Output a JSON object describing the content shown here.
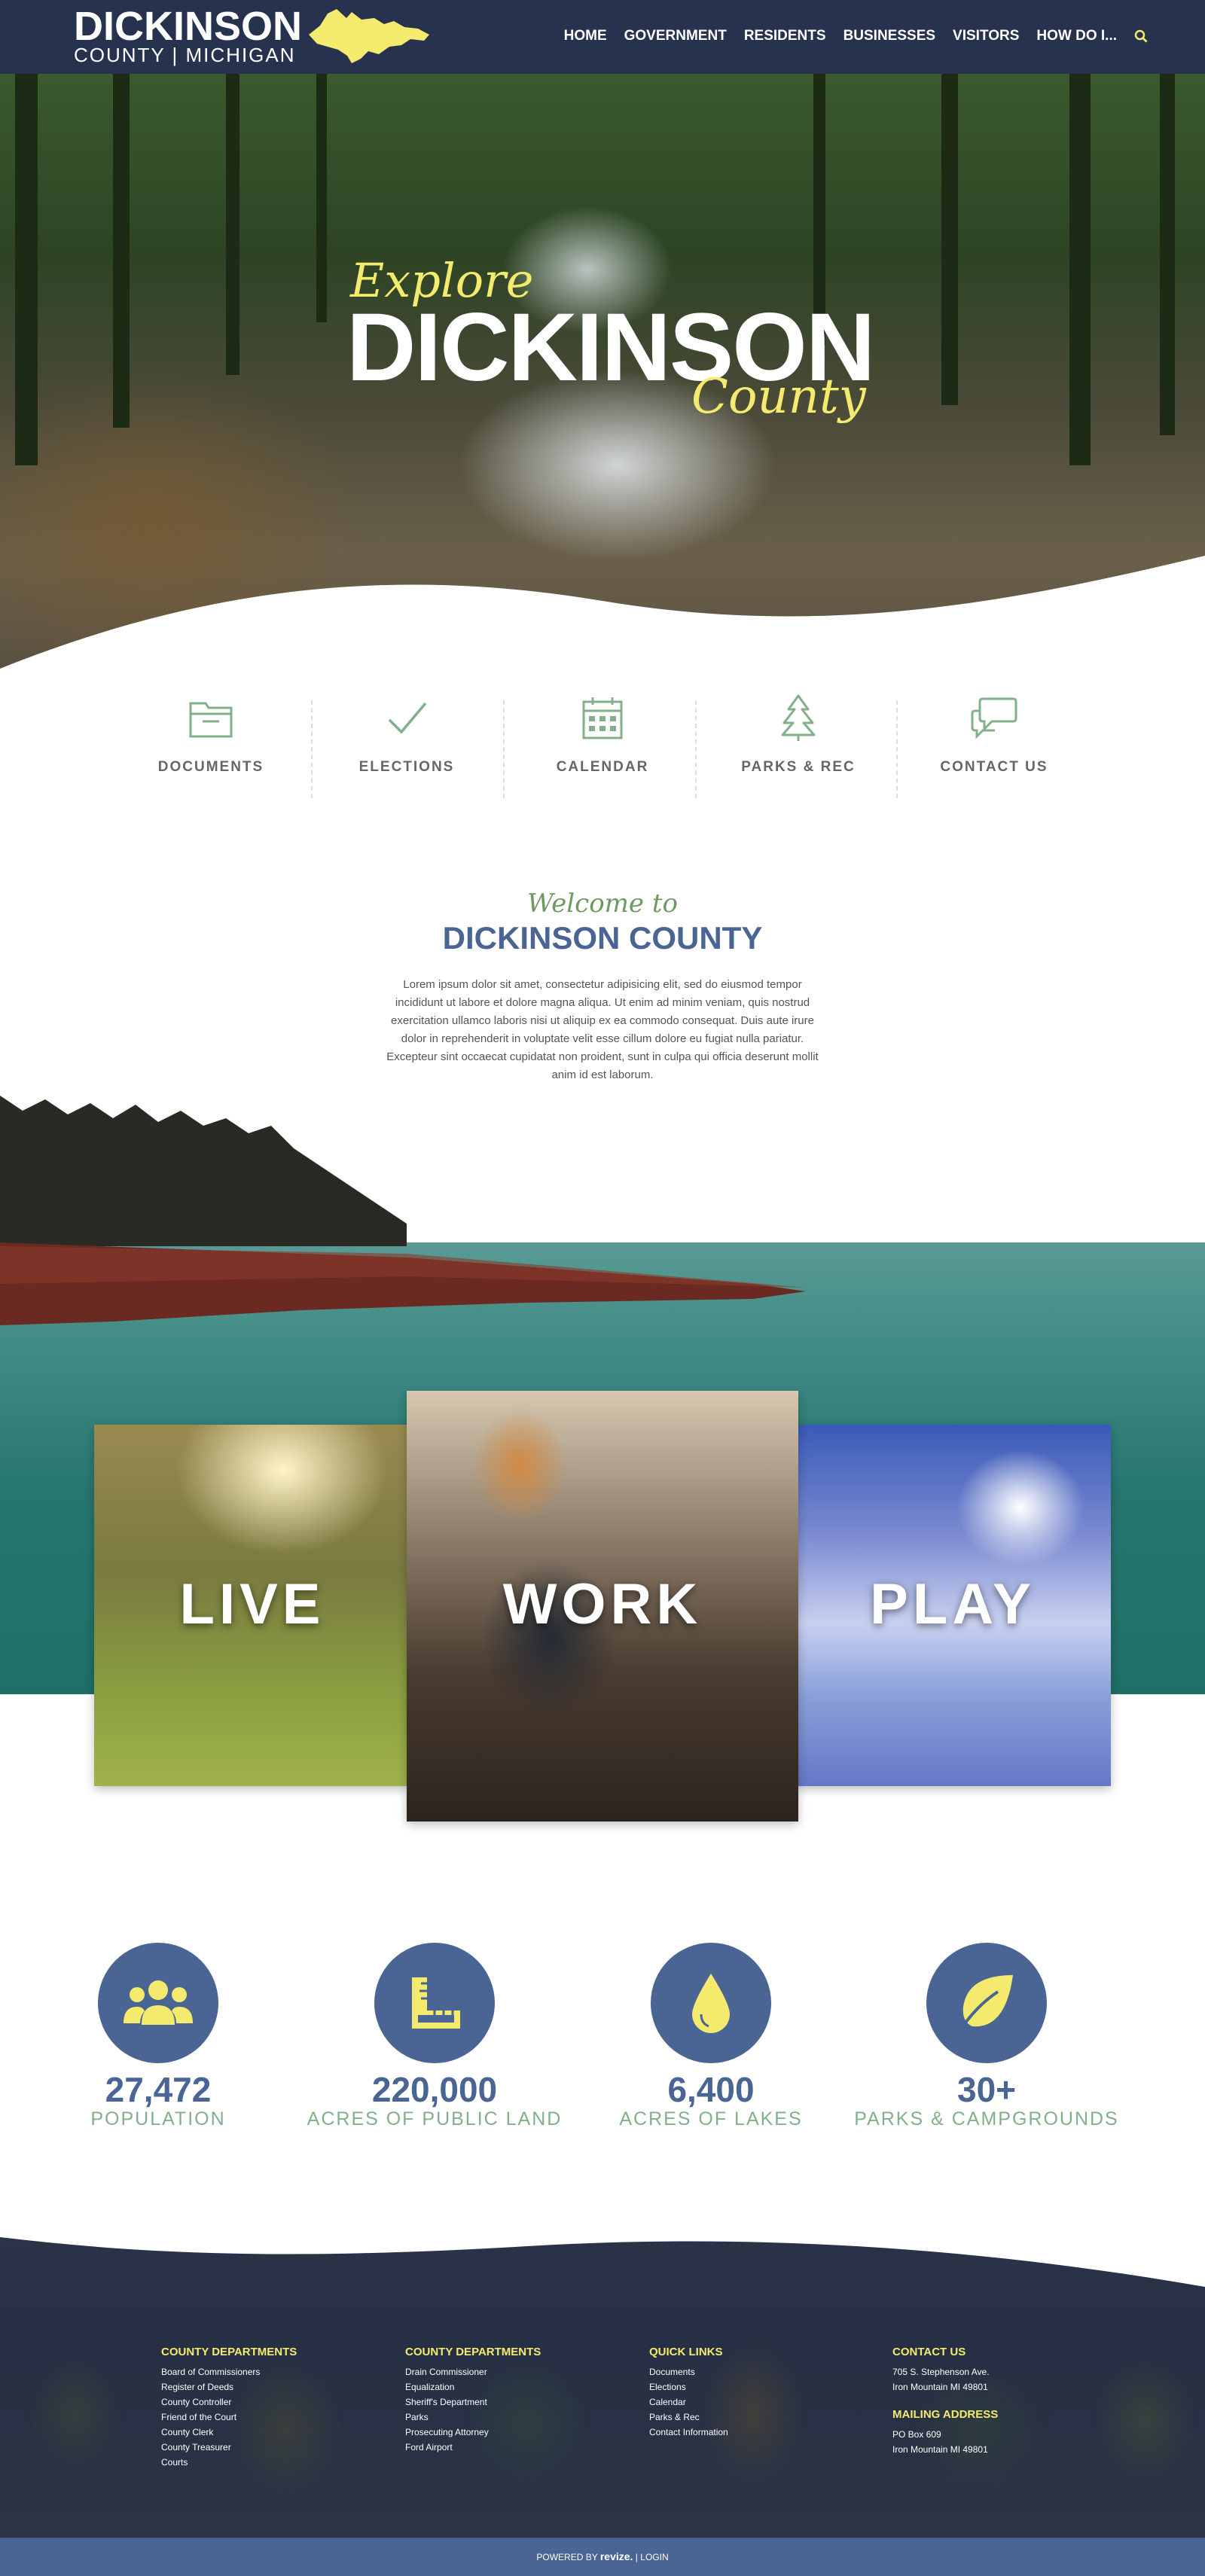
{
  "header": {
    "logo_line1": "DICKINSON",
    "logo_line2": "COUNTY | MICHIGAN",
    "nav": [
      "HOME",
      "GOVERNMENT",
      "RESIDENTS",
      "BUSINESSES",
      "VISITORS",
      "HOW DO I..."
    ]
  },
  "hero": {
    "script_top": "Explore",
    "title": "DICKINSON",
    "script_bottom": "County"
  },
  "quick_links": [
    "DOCUMENTS",
    "ELECTIONS",
    "CALENDAR",
    "PARKS & REC",
    "CONTACT US"
  ],
  "welcome": {
    "script": "Welcome to",
    "title": "DICKINSON COUNTY",
    "body": "Lorem ipsum dolor sit amet, consectetur adipisicing elit, sed do eiusmod tempor incididunt ut labore et dolore magna aliqua. Ut enim ad minim veniam, quis nostrud exercitation ullamco laboris nisi ut aliquip ex ea commodo consequat. Duis aute irure dolor in reprehenderit in voluptate velit esse cillum dolore eu fugiat nulla pariatur. Excepteur sint occaecat cupidatat non proident, sunt in culpa qui officia deserunt mollit anim id est laborum."
  },
  "cards": [
    "LIVE",
    "WORK",
    "PLAY"
  ],
  "stats": [
    {
      "value": "27,472",
      "label": "POPULATION",
      "icon": "people-icon"
    },
    {
      "value": "220,000",
      "label": "ACRES OF PUBLIC LAND",
      "icon": "ruler-icon"
    },
    {
      "value": "6,400",
      "label": "ACRES OF LAKES",
      "icon": "water-drop-icon"
    },
    {
      "value": "30+",
      "label": "PARKS & CAMPGROUNDS",
      "icon": "leaf-icon"
    }
  ],
  "footer": {
    "col1": {
      "title": "COUNTY DEPARTMENTS",
      "items": [
        "Board of Commissioners",
        "Register of Deeds",
        "County Controller",
        "Friend of the Court",
        "County Clerk",
        "County Treasurer",
        "Courts"
      ]
    },
    "col2": {
      "title": "COUNTY DEPARTMENTS",
      "items": [
        "Drain Commissioner",
        "Equalization",
        "Sheriff's Department",
        "Parks",
        "Prosecuting Attorney",
        "Ford Airport"
      ]
    },
    "col3": {
      "title": "QUICK LINKS",
      "items": [
        "Documents",
        "Elections",
        "Calendar",
        "Parks & Rec",
        "Contact Information"
      ]
    },
    "col4": {
      "title": "CONTACT US",
      "items": [
        "705 S. Stephenson Ave.",
        "Iron Mountain MI 49801"
      ],
      "title2": "MAILING ADDRESS",
      "items2": [
        "PO Box 609",
        "Iron Mountain MI 49801"
      ]
    }
  },
  "bottom_bar": {
    "powered": "POWERED BY",
    "brand": "revize.",
    "sep": "|",
    "login": "LOGIN"
  },
  "colors": {
    "navy": "#27324f",
    "accent_yellow": "#f4ea6e",
    "blue": "#4a6593",
    "green": "#82b08a"
  }
}
